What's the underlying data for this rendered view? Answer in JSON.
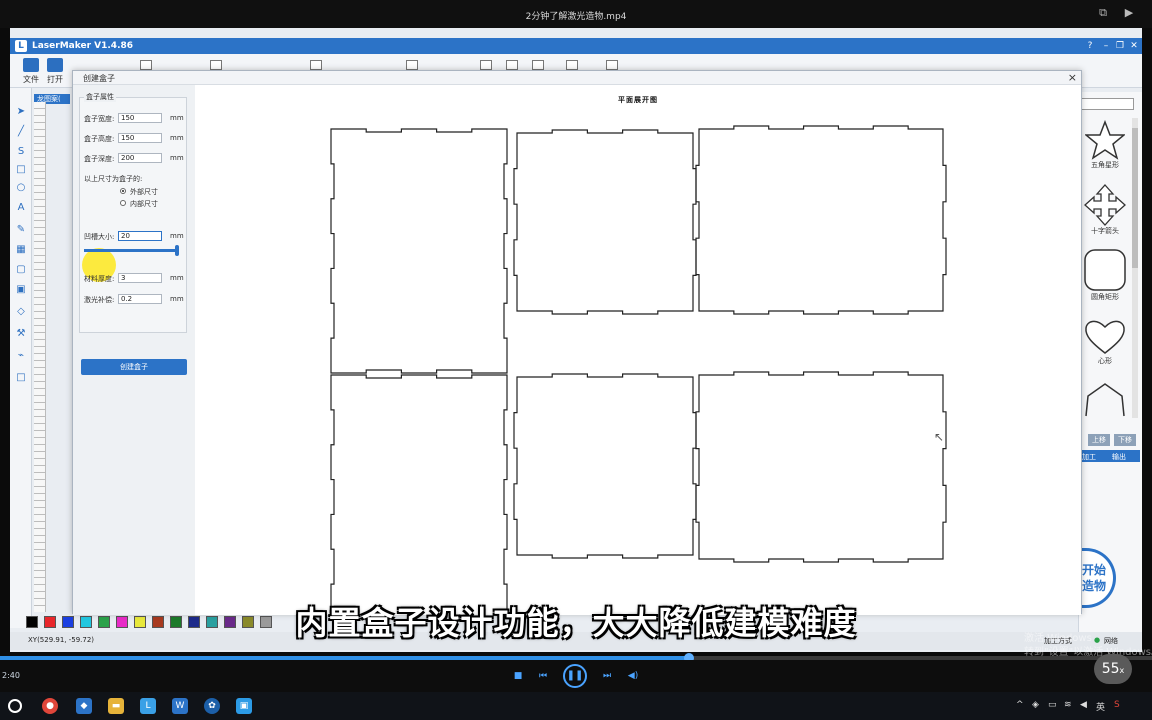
{
  "player": {
    "title": "2分钟了解激光造物.mp4",
    "time_current": "2:40",
    "progress_fraction": 0.598,
    "speed_badge": "55",
    "speed_unit": "x"
  },
  "subtitle": "内置盒子设计功能，大大降低建模难度",
  "watermark": {
    "line1": "激活 Windows",
    "line2": "转到\"设置\"以激活 Windows。"
  },
  "app": {
    "title": "LaserMaker V1.4.86",
    "toolbar": {
      "file_label": "文件",
      "open_label": "打开"
    },
    "layer_tab": "龙图案(",
    "status_coords": "XY(529.91, -59.72)",
    "right_panel": {
      "shapes": [
        {
          "name": "star",
          "label": "五角星形"
        },
        {
          "name": "cross-arrow",
          "label": "十字箭头"
        },
        {
          "name": "rounded-rect",
          "label": "圆角矩形"
        },
        {
          "name": "heart",
          "label": "心形"
        }
      ],
      "move_up": "上移",
      "move_down": "下移",
      "tab_left": "加工",
      "tab_right": "输出",
      "start_label_1": "开始",
      "start_label_2": "造物",
      "machine_mode": "加工方式",
      "connection": "网络"
    },
    "palette_colors": [
      "#000000",
      "#e8262b",
      "#1b3fe0",
      "#22c7e0",
      "#2ba24a",
      "#e82bc7",
      "#e8e83b",
      "#a83a1f",
      "#1c7a2a",
      "#1c2a8a",
      "#2aa0a0",
      "#6a2a8a",
      "#8a8a2a",
      "#9a9a9a"
    ]
  },
  "dialog": {
    "title": "创建盒子",
    "group_title": "盒子属性",
    "width_label": "盒子宽度:",
    "width_value": "150",
    "height_label": "盒子高度:",
    "height_value": "150",
    "depth_label": "盒子深度:",
    "depth_value": "200",
    "unit": "mm",
    "size_note": "以上尺寸为盒子的:",
    "option_outer": "外部尺寸",
    "option_inner": "内部尺寸",
    "option_selected": "外部尺寸",
    "tab_label": "凹槽大小:",
    "tab_value": "20",
    "thickness_label": "材料厚度:",
    "thickness_value": "3",
    "kerf_label": "激光补偿:",
    "kerf_value": "0.2",
    "create_button": "创建盒子",
    "canvas_title": "平面展开图"
  },
  "accent": "#2c73c7"
}
